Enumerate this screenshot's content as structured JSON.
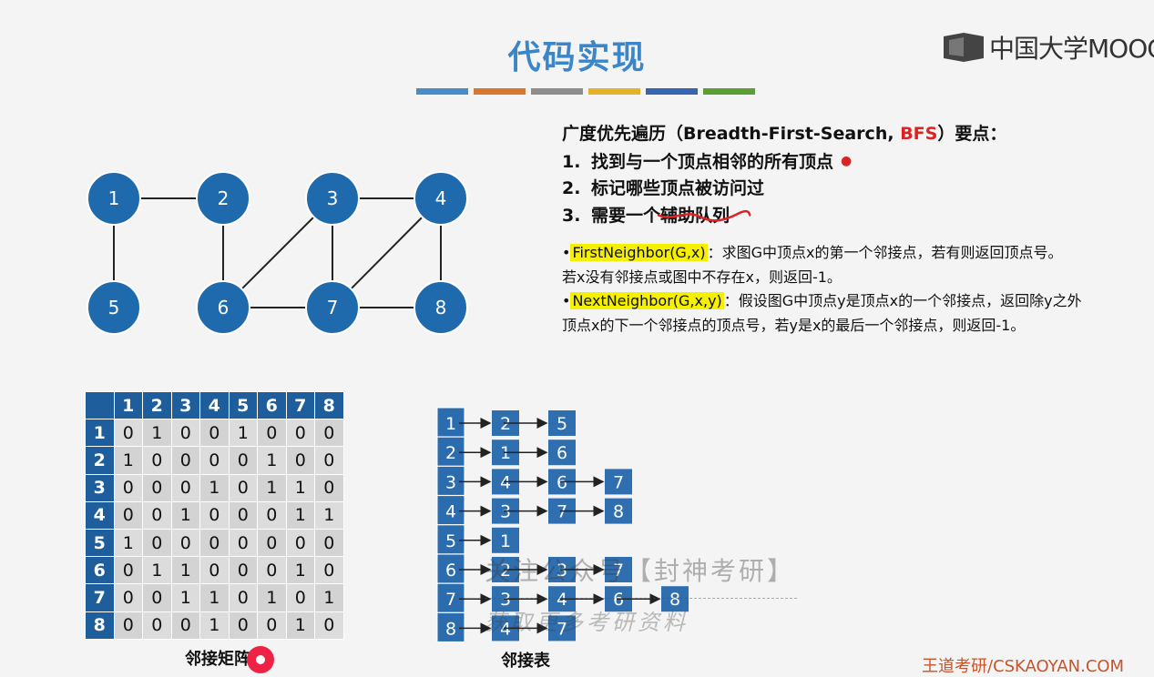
{
  "header": {
    "title": "代码实现",
    "stripes": [
      "#4a8dc6",
      "#d5772e",
      "#8d8d8d",
      "#e4b12a",
      "#3565b0",
      "#5b9e35"
    ]
  },
  "logo": {
    "text": "中国大学MOOC",
    "icon": "mooc-logo-icon"
  },
  "bfs_points": {
    "heading_prefix": "广度优先遍历（Breadth-First-Search, ",
    "heading_highlight": "BFS",
    "heading_suffix": "）要点：",
    "items": [
      {
        "num": "1.",
        "text": "找到与一个顶点相邻的所有顶点"
      },
      {
        "num": "2.",
        "text": "标记哪些顶点被访问过"
      },
      {
        "num": "3.",
        "text_plain": "需要一个",
        "text_emph": "辅助队列"
      }
    ]
  },
  "definitions": [
    {
      "bullet": "•",
      "name": "FirstNeighbor(G,x)",
      "desc": "：求图G中顶点x的第一个邻接点，若有则返回顶点号。",
      "desc2": "若x没有邻接点或图中不存在x，则返回-1。"
    },
    {
      "bullet": "•",
      "name": "NextNeighbor(G,x,y)",
      "desc": "：假设图G中顶点y是顶点x的一个邻接点，返回除y之外",
      "desc2": "顶点x的下一个邻接点的顶点号，若y是x的最后一个邻接点，则返回-1。"
    }
  ],
  "graph": {
    "node_color": "#1e6aac",
    "vertices": [
      "1",
      "2",
      "3",
      "4",
      "5",
      "6",
      "7",
      "8"
    ],
    "edges": [
      [
        "1",
        "2"
      ],
      [
        "1",
        "5"
      ],
      [
        "2",
        "6"
      ],
      [
        "3",
        "4"
      ],
      [
        "3",
        "6"
      ],
      [
        "3",
        "7"
      ],
      [
        "4",
        "7"
      ],
      [
        "4",
        "8"
      ],
      [
        "6",
        "7"
      ],
      [
        "7",
        "8"
      ]
    ]
  },
  "matrix": {
    "caption": "邻接矩阵",
    "labels": [
      "1",
      "2",
      "3",
      "4",
      "5",
      "6",
      "7",
      "8"
    ],
    "rows": [
      [
        "0",
        "1",
        "0",
        "0",
        "1",
        "0",
        "0",
        "0"
      ],
      [
        "1",
        "0",
        "0",
        "0",
        "0",
        "1",
        "0",
        "0"
      ],
      [
        "0",
        "0",
        "0",
        "1",
        "0",
        "1",
        "1",
        "0"
      ],
      [
        "0",
        "0",
        "1",
        "0",
        "0",
        "0",
        "1",
        "1"
      ],
      [
        "1",
        "0",
        "0",
        "0",
        "0",
        "0",
        "0",
        "0"
      ],
      [
        "0",
        "1",
        "1",
        "0",
        "0",
        "0",
        "1",
        "0"
      ],
      [
        "0",
        "0",
        "1",
        "1",
        "0",
        "1",
        "0",
        "1"
      ],
      [
        "0",
        "0",
        "0",
        "1",
        "0",
        "0",
        "1",
        "0"
      ]
    ]
  },
  "adjacency_list": {
    "caption": "邻接表",
    "heads": [
      "1",
      "2",
      "3",
      "4",
      "5",
      "6",
      "7",
      "8"
    ],
    "lists": [
      [
        "2",
        "5"
      ],
      [
        "1",
        "6"
      ],
      [
        "4",
        "6",
        "7"
      ],
      [
        "3",
        "7",
        "8"
      ],
      [
        "1"
      ],
      [
        "2",
        "3",
        "7"
      ],
      [
        "3",
        "4",
        "6",
        "8"
      ],
      [
        "4",
        "7"
      ]
    ]
  },
  "watermark": {
    "line1": "关注公众号【封神考研】",
    "line2": "获取更多考研资料"
  },
  "footer": "王道考研/CSKAOYAN.COM"
}
